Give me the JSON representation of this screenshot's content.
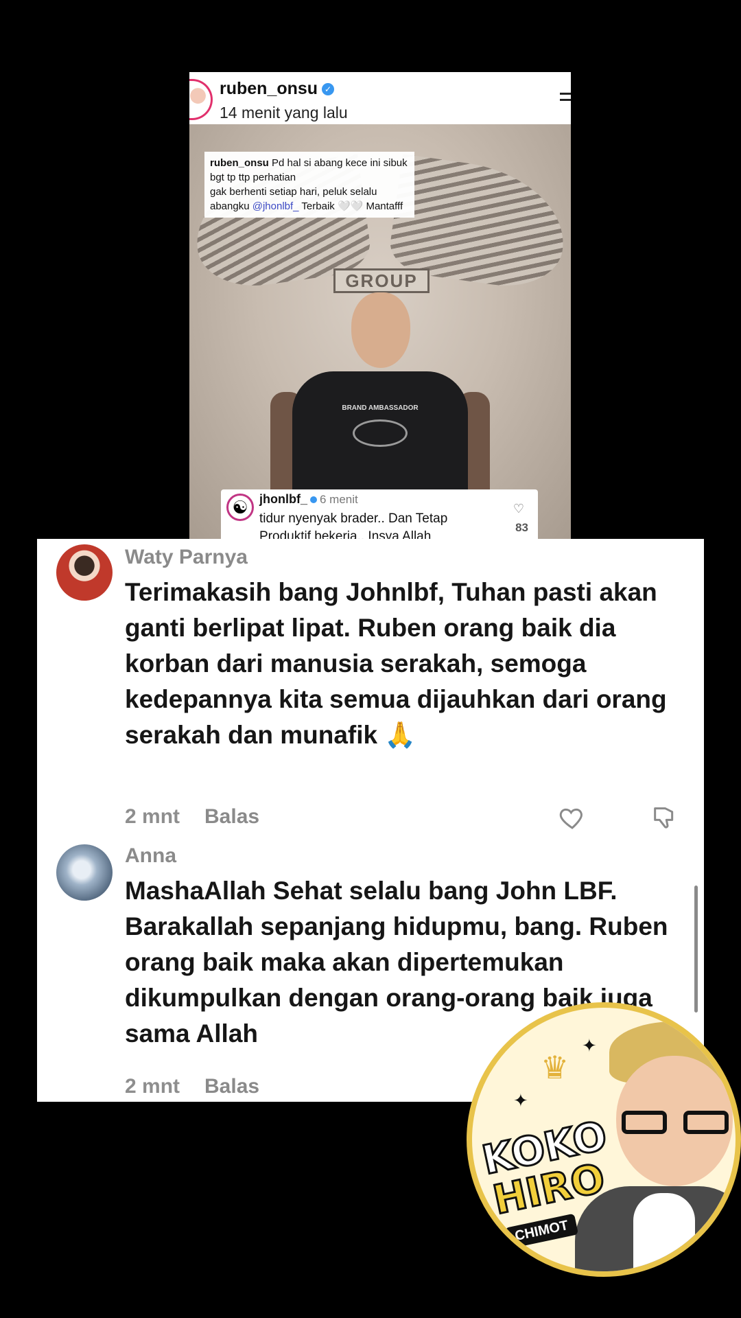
{
  "story": {
    "username": "ruben_onsu",
    "time_ago": "14 menit yang lalu",
    "caption_user": "ruben_onsu",
    "caption_line1": "Pd hal si abang kece ini sibuk bgt tp ttp perhatian",
    "caption_line2": "gak berhenti setiap hari, peluk selalu",
    "caption_line3_prefix": "abangku",
    "caption_mention": "@jhonlbf_",
    "caption_line3_suffix": "Terbaik 🤍🤍 Mantafff",
    "photo_sign": "GROUP",
    "shirt_text": "BRAND AMBASSADOR",
    "reply": {
      "username": "jhonlbf_",
      "time": "6 menit",
      "text": "tidur nyenyak brader.. Dan Tetap Produktif bekerja.. Insya Allah",
      "likes": "83"
    }
  },
  "comments": [
    {
      "name": "Waty Parnya",
      "text": "Terimakasih bang Johnlbf, Tuhan pasti akan ganti berlipat lipat. Ruben orang baik dia korban dari manusia serakah, semoga kedepannya kita semua dijauhkan dari orang serakah dan munafik 🙏",
      "time": "2 mnt",
      "reply_label": "Balas"
    },
    {
      "name": "Anna",
      "text": "MashaAllah Sehat selalu bang John LBF. Barakallah sepanjang hidupmu, bang. Ruben orang baik maka akan dipertemukan dikumpulkan dengan orang-orang baik juga sama Allah",
      "time": "2 mnt",
      "reply_label": "Balas"
    }
  ],
  "sticker": {
    "line1": "KOKO",
    "line2": "HIRO",
    "line3": "CHIMOT"
  },
  "colors": {
    "background": "#000000",
    "panel": "#ffffff",
    "muted_text": "#8a8a8a",
    "verified": "#3897f0",
    "mention": "#3b49c4"
  }
}
